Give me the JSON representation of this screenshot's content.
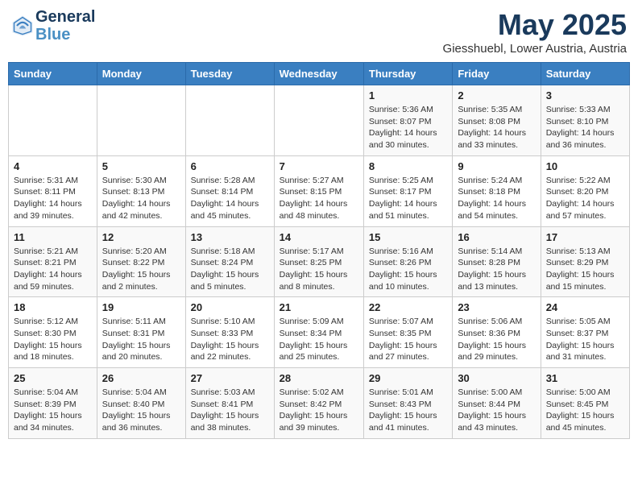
{
  "header": {
    "logo_line1": "General",
    "logo_line2": "Blue",
    "month": "May 2025",
    "location": "Giesshuebl, Lower Austria, Austria"
  },
  "weekdays": [
    "Sunday",
    "Monday",
    "Tuesday",
    "Wednesday",
    "Thursday",
    "Friday",
    "Saturday"
  ],
  "weeks": [
    [
      {
        "day": "",
        "info": ""
      },
      {
        "day": "",
        "info": ""
      },
      {
        "day": "",
        "info": ""
      },
      {
        "day": "",
        "info": ""
      },
      {
        "day": "1",
        "info": "Sunrise: 5:36 AM\nSunset: 8:07 PM\nDaylight: 14 hours\nand 30 minutes."
      },
      {
        "day": "2",
        "info": "Sunrise: 5:35 AM\nSunset: 8:08 PM\nDaylight: 14 hours\nand 33 minutes."
      },
      {
        "day": "3",
        "info": "Sunrise: 5:33 AM\nSunset: 8:10 PM\nDaylight: 14 hours\nand 36 minutes."
      }
    ],
    [
      {
        "day": "4",
        "info": "Sunrise: 5:31 AM\nSunset: 8:11 PM\nDaylight: 14 hours\nand 39 minutes."
      },
      {
        "day": "5",
        "info": "Sunrise: 5:30 AM\nSunset: 8:13 PM\nDaylight: 14 hours\nand 42 minutes."
      },
      {
        "day": "6",
        "info": "Sunrise: 5:28 AM\nSunset: 8:14 PM\nDaylight: 14 hours\nand 45 minutes."
      },
      {
        "day": "7",
        "info": "Sunrise: 5:27 AM\nSunset: 8:15 PM\nDaylight: 14 hours\nand 48 minutes."
      },
      {
        "day": "8",
        "info": "Sunrise: 5:25 AM\nSunset: 8:17 PM\nDaylight: 14 hours\nand 51 minutes."
      },
      {
        "day": "9",
        "info": "Sunrise: 5:24 AM\nSunset: 8:18 PM\nDaylight: 14 hours\nand 54 minutes."
      },
      {
        "day": "10",
        "info": "Sunrise: 5:22 AM\nSunset: 8:20 PM\nDaylight: 14 hours\nand 57 minutes."
      }
    ],
    [
      {
        "day": "11",
        "info": "Sunrise: 5:21 AM\nSunset: 8:21 PM\nDaylight: 14 hours\nand 59 minutes."
      },
      {
        "day": "12",
        "info": "Sunrise: 5:20 AM\nSunset: 8:22 PM\nDaylight: 15 hours\nand 2 minutes."
      },
      {
        "day": "13",
        "info": "Sunrise: 5:18 AM\nSunset: 8:24 PM\nDaylight: 15 hours\nand 5 minutes."
      },
      {
        "day": "14",
        "info": "Sunrise: 5:17 AM\nSunset: 8:25 PM\nDaylight: 15 hours\nand 8 minutes."
      },
      {
        "day": "15",
        "info": "Sunrise: 5:16 AM\nSunset: 8:26 PM\nDaylight: 15 hours\nand 10 minutes."
      },
      {
        "day": "16",
        "info": "Sunrise: 5:14 AM\nSunset: 8:28 PM\nDaylight: 15 hours\nand 13 minutes."
      },
      {
        "day": "17",
        "info": "Sunrise: 5:13 AM\nSunset: 8:29 PM\nDaylight: 15 hours\nand 15 minutes."
      }
    ],
    [
      {
        "day": "18",
        "info": "Sunrise: 5:12 AM\nSunset: 8:30 PM\nDaylight: 15 hours\nand 18 minutes."
      },
      {
        "day": "19",
        "info": "Sunrise: 5:11 AM\nSunset: 8:31 PM\nDaylight: 15 hours\nand 20 minutes."
      },
      {
        "day": "20",
        "info": "Sunrise: 5:10 AM\nSunset: 8:33 PM\nDaylight: 15 hours\nand 22 minutes."
      },
      {
        "day": "21",
        "info": "Sunrise: 5:09 AM\nSunset: 8:34 PM\nDaylight: 15 hours\nand 25 minutes."
      },
      {
        "day": "22",
        "info": "Sunrise: 5:07 AM\nSunset: 8:35 PM\nDaylight: 15 hours\nand 27 minutes."
      },
      {
        "day": "23",
        "info": "Sunrise: 5:06 AM\nSunset: 8:36 PM\nDaylight: 15 hours\nand 29 minutes."
      },
      {
        "day": "24",
        "info": "Sunrise: 5:05 AM\nSunset: 8:37 PM\nDaylight: 15 hours\nand 31 minutes."
      }
    ],
    [
      {
        "day": "25",
        "info": "Sunrise: 5:04 AM\nSunset: 8:39 PM\nDaylight: 15 hours\nand 34 minutes."
      },
      {
        "day": "26",
        "info": "Sunrise: 5:04 AM\nSunset: 8:40 PM\nDaylight: 15 hours\nand 36 minutes."
      },
      {
        "day": "27",
        "info": "Sunrise: 5:03 AM\nSunset: 8:41 PM\nDaylight: 15 hours\nand 38 minutes."
      },
      {
        "day": "28",
        "info": "Sunrise: 5:02 AM\nSunset: 8:42 PM\nDaylight: 15 hours\nand 39 minutes."
      },
      {
        "day": "29",
        "info": "Sunrise: 5:01 AM\nSunset: 8:43 PM\nDaylight: 15 hours\nand 41 minutes."
      },
      {
        "day": "30",
        "info": "Sunrise: 5:00 AM\nSunset: 8:44 PM\nDaylight: 15 hours\nand 43 minutes."
      },
      {
        "day": "31",
        "info": "Sunrise: 5:00 AM\nSunset: 8:45 PM\nDaylight: 15 hours\nand 45 minutes."
      }
    ]
  ]
}
